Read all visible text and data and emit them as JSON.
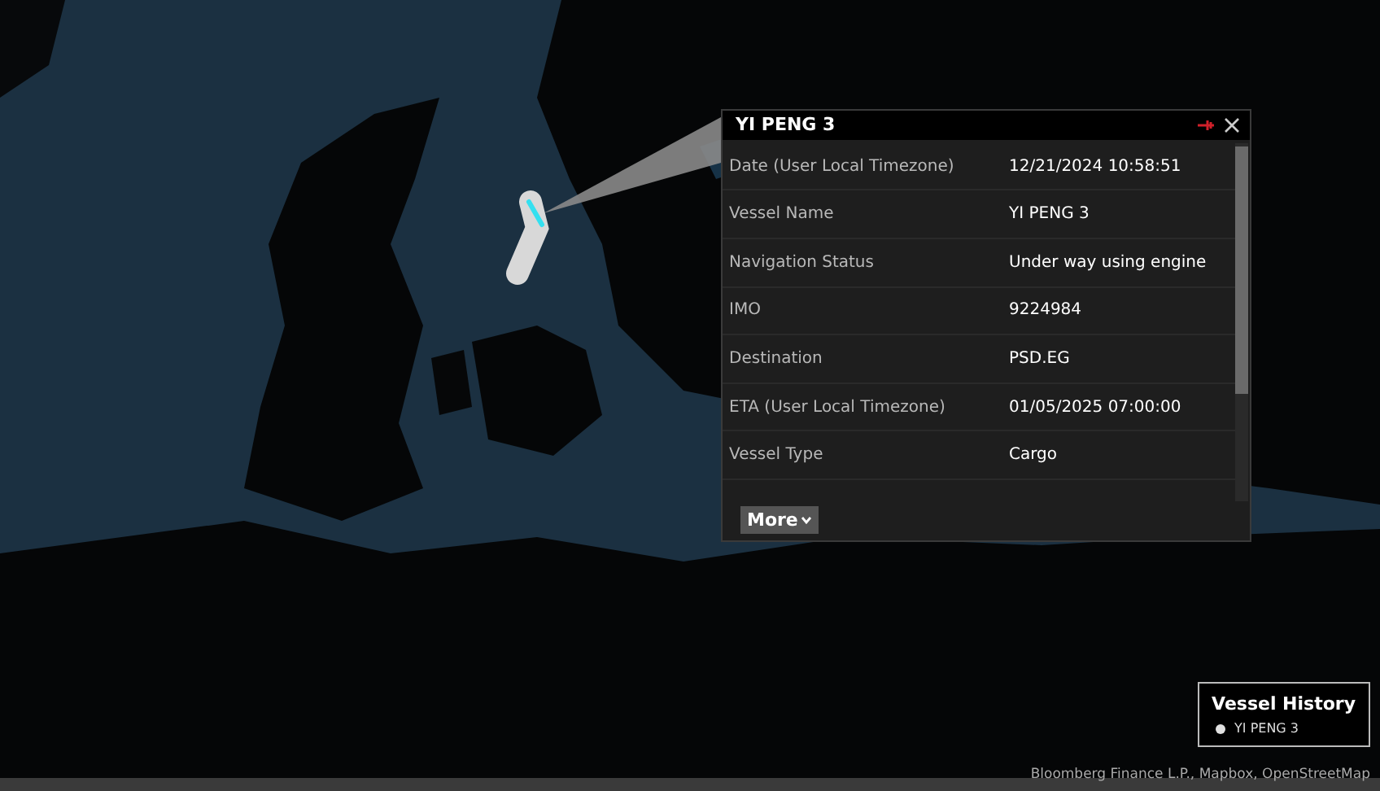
{
  "popup": {
    "title": "YI PENG 3",
    "rows": [
      {
        "label": "Date (User Local Timezone)",
        "value": "12/21/2024 10:58:51"
      },
      {
        "label": "Vessel Name",
        "value": "YI PENG 3"
      },
      {
        "label": "Navigation Status",
        "value": "Under way using engine"
      },
      {
        "label": "IMO",
        "value": "9224984"
      },
      {
        "label": "Destination",
        "value": "PSD.EG"
      },
      {
        "label": "ETA (User Local Timezone)",
        "value": "01/05/2025 07:00:00"
      },
      {
        "label": "Vessel Type",
        "value": "Cargo"
      }
    ],
    "more_button": "More"
  },
  "legend": {
    "title": "Vessel History",
    "items": [
      {
        "label": "YI PENG 3"
      }
    ]
  },
  "attribution": "Bloomberg Finance L.P., Mapbox, OpenStreetMap"
}
